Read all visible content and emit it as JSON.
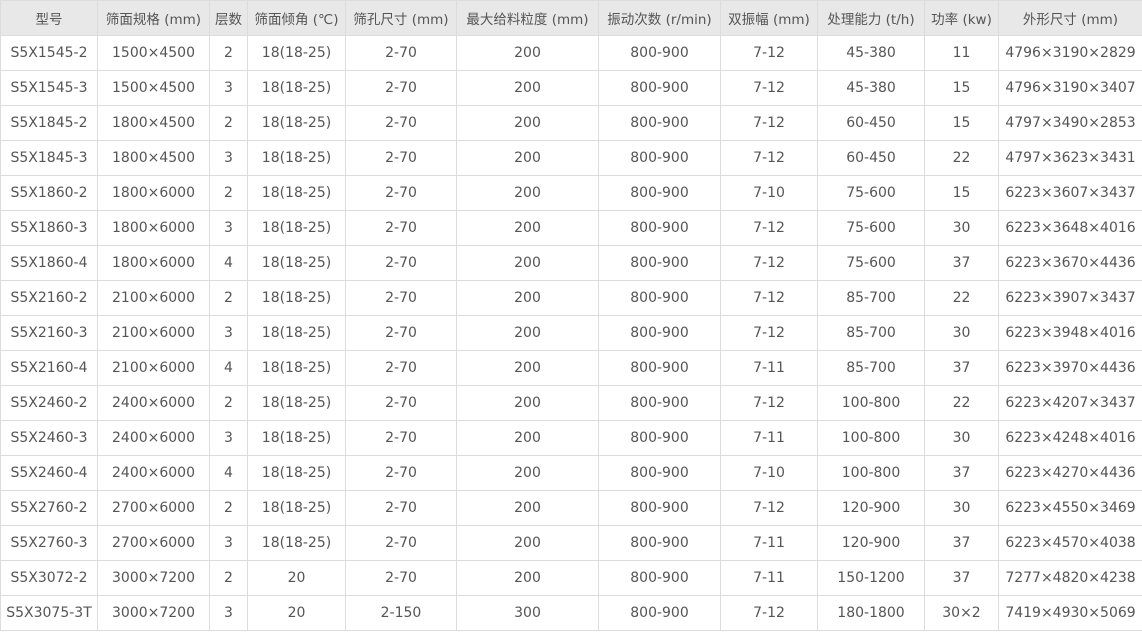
{
  "table": {
    "columns": [
      "型号",
      "筛面规格 (mm)",
      "层数",
      "筛面倾角 (℃)",
      "筛孔尺寸 (mm)",
      "最大给料粒度 (mm)",
      "振动次数 (r/min)",
      "双振幅 (mm)",
      "处理能力 (t/h)",
      "功率 (kw)",
      "外形尺寸 (mm)"
    ],
    "rows": [
      [
        "S5X1545-2",
        "1500×4500",
        "2",
        "18(18-25)",
        "2-70",
        "200",
        "800-900",
        "7-12",
        "45-380",
        "11",
        "4796×3190×2829"
      ],
      [
        "S5X1545-3",
        "1500×4500",
        "3",
        "18(18-25)",
        "2-70",
        "200",
        "800-900",
        "7-12",
        "45-380",
        "15",
        "4796×3190×3407"
      ],
      [
        "S5X1845-2",
        "1800×4500",
        "2",
        "18(18-25)",
        "2-70",
        "200",
        "800-900",
        "7-12",
        "60-450",
        "15",
        "4797×3490×2853"
      ],
      [
        "S5X1845-3",
        "1800×4500",
        "3",
        "18(18-25)",
        "2-70",
        "200",
        "800-900",
        "7-12",
        "60-450",
        "22",
        "4797×3623×3431"
      ],
      [
        "S5X1860-2",
        "1800×6000",
        "2",
        "18(18-25)",
        "2-70",
        "200",
        "800-900",
        "7-10",
        "75-600",
        "15",
        "6223×3607×3437"
      ],
      [
        "S5X1860-3",
        "1800×6000",
        "3",
        "18(18-25)",
        "2-70",
        "200",
        "800-900",
        "7-12",
        "75-600",
        "30",
        "6223×3648×4016"
      ],
      [
        "S5X1860-4",
        "1800×6000",
        "4",
        "18(18-25)",
        "2-70",
        "200",
        "800-900",
        "7-12",
        "75-600",
        "37",
        "6223×3670×4436"
      ],
      [
        "S5X2160-2",
        "2100×6000",
        "2",
        "18(18-25)",
        "2-70",
        "200",
        "800-900",
        "7-12",
        "85-700",
        "22",
        "6223×3907×3437"
      ],
      [
        "S5X2160-3",
        "2100×6000",
        "3",
        "18(18-25)",
        "2-70",
        "200",
        "800-900",
        "7-12",
        "85-700",
        "30",
        "6223×3948×4016"
      ],
      [
        "S5X2160-4",
        "2100×6000",
        "4",
        "18(18-25)",
        "2-70",
        "200",
        "800-900",
        "7-11",
        "85-700",
        "37",
        "6223×3970×4436"
      ],
      [
        "S5X2460-2",
        "2400×6000",
        "2",
        "18(18-25)",
        "2-70",
        "200",
        "800-900",
        "7-12",
        "100-800",
        "22",
        "6223×4207×3437"
      ],
      [
        "S5X2460-3",
        "2400×6000",
        "3",
        "18(18-25)",
        "2-70",
        "200",
        "800-900",
        "7-11",
        "100-800",
        "30",
        "6223×4248×4016"
      ],
      [
        "S5X2460-4",
        "2400×6000",
        "4",
        "18(18-25)",
        "2-70",
        "200",
        "800-900",
        "7-10",
        "100-800",
        "37",
        "6223×4270×4436"
      ],
      [
        "S5X2760-2",
        "2700×6000",
        "2",
        "18(18-25)",
        "2-70",
        "200",
        "800-900",
        "7-12",
        "120-900",
        "30",
        "6223×4550×3469"
      ],
      [
        "S5X2760-3",
        "2700×6000",
        "3",
        "18(18-25)",
        "2-70",
        "200",
        "800-900",
        "7-11",
        "120-900",
        "37",
        "6223×4570×4038"
      ],
      [
        "S5X3072-2",
        "3000×7200",
        "2",
        "20",
        "2-70",
        "200",
        "800-900",
        "7-11",
        "150-1200",
        "37",
        "7277×4820×4238"
      ],
      [
        "S5X3075-3T",
        "3000×7200",
        "3",
        "20",
        "2-150",
        "300",
        "800-900",
        "7-12",
        "180-1800",
        "30×2",
        "7419×4930×5069"
      ]
    ]
  }
}
